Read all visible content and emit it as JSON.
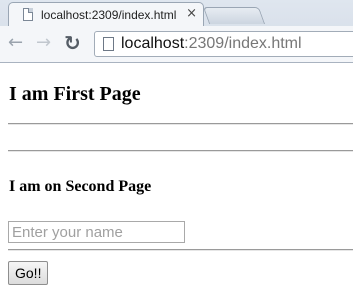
{
  "browser": {
    "tab_title": "localhost:2309/index.html",
    "tab_close_glyph": "×",
    "icons": {
      "tab": "page-icon",
      "close": "close-icon",
      "back": "back-arrow-icon",
      "forward": "forward-arrow-icon",
      "reload": "reload-icon",
      "omnibox": "page-icon"
    },
    "back_glyph": "←",
    "forward_glyph": "→",
    "reload_glyph": "↻",
    "address": {
      "host": "localhost",
      "path": ":2309/index.html"
    }
  },
  "page": {
    "heading_first": "I am First Page",
    "heading_second": "I am on Second Page",
    "name_input": {
      "value": "",
      "placeholder": "Enter your name"
    },
    "go_button_label": "Go!!"
  }
}
